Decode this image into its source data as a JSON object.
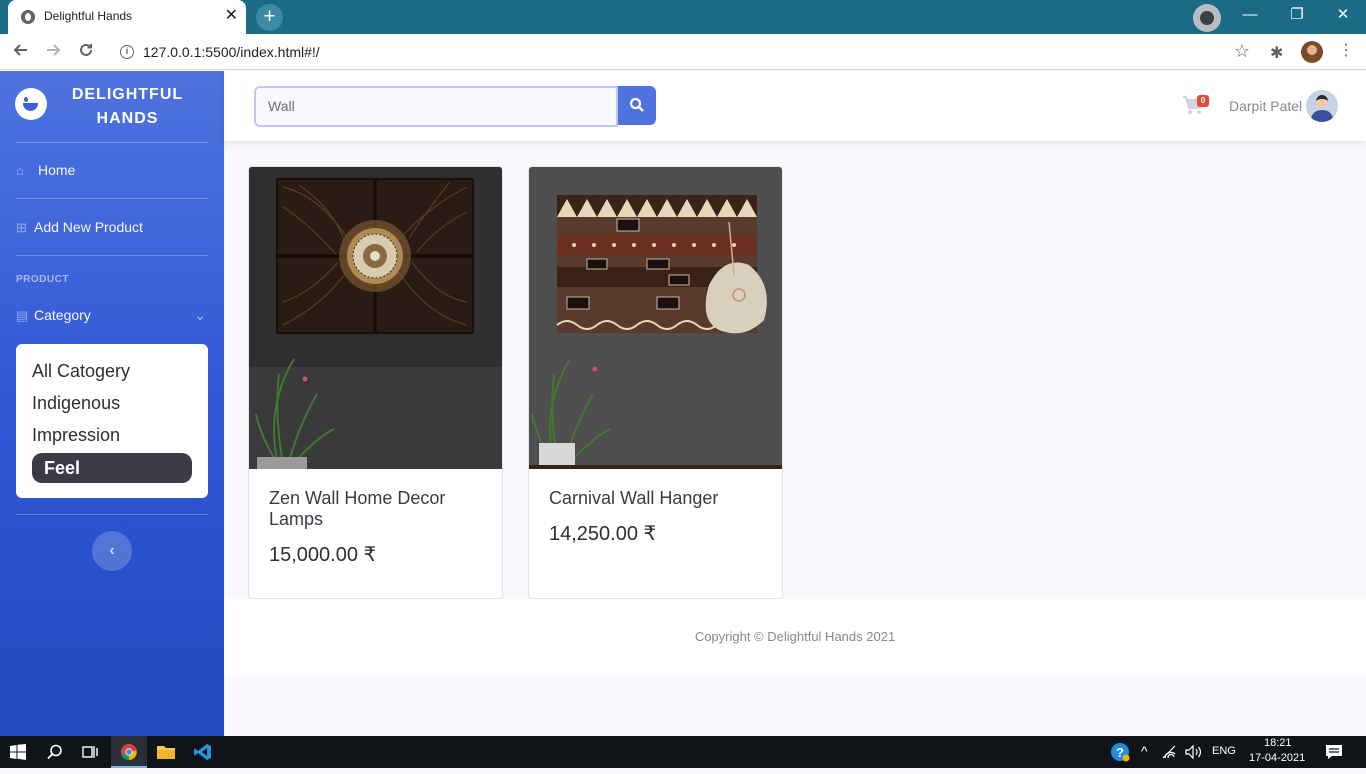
{
  "browser": {
    "tab_title": "Delightful Hands",
    "tab_close": "✕",
    "new_tab": "+",
    "url": "127.0.0.1:5500/index.html#!/",
    "window_controls": [
      "—",
      "❐",
      "✕"
    ]
  },
  "sidebar": {
    "brand": "DELIGHTFUL HANDS",
    "home_label": "Home",
    "add_product_label": "Add New Product",
    "section_heading": "PRODUCT",
    "category_label": "Category",
    "categories": [
      {
        "label": "All Catogery",
        "active": false
      },
      {
        "label": "Indigenous",
        "active": false
      },
      {
        "label": "Impression",
        "active": false
      },
      {
        "label": "Feel",
        "active": true
      }
    ],
    "toggle_symbol": "‹"
  },
  "topbar": {
    "search_value": "Wall",
    "cart_count": "0",
    "user_name": "Darpit Patel"
  },
  "products": [
    {
      "name": "Zen Wall Home Decor Lamps",
      "price": "15,000.00 ₹"
    },
    {
      "name": "Carnival Wall Hanger",
      "price": "14,250.00 ₹"
    }
  ],
  "footer": {
    "copyright": "Copyright © Delightful Hands 2021"
  },
  "taskbar": {
    "language": "ENG",
    "time": "18:21",
    "date": "17-04-2021"
  },
  "colors": {
    "primary": "#4e73df",
    "sidebar_dark": "#224abe",
    "badge": "#e74a3b",
    "tabbar": "#1b6b86"
  },
  "icons": [
    "globe-icon",
    "plus-icon",
    "info-icon",
    "star-icon",
    "puzzle-icon",
    "home-icon",
    "plus-square-icon",
    "clipboard-icon",
    "chevron-down-icon",
    "chevron-left-icon",
    "search-icon",
    "cart-icon",
    "windows-icon",
    "taskview-icon",
    "chrome-icon",
    "folder-icon",
    "vscode-icon",
    "help-icon",
    "wifi-icon",
    "volume-icon",
    "notification-icon"
  ]
}
